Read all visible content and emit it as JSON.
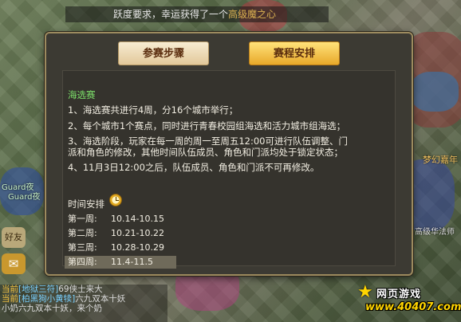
{
  "notice": {
    "prefix": "跃度要求，幸运获得了一个",
    "highlight": "高级魔之心"
  },
  "side": {
    "guard1": "Guard夜",
    "guard2": "Guard夜",
    "friend": "好友",
    "chat_icon": "chat-bubble-icon"
  },
  "right_signs": {
    "sign1": "梦幻嘉年",
    "sign2": "高级华法师"
  },
  "chat": [
    {
      "channel": "当前",
      "name": "[地狱三符]",
      "text": "69侠士来大"
    },
    {
      "channel": "当前",
      "name": "[柏黑狗小黄犊]",
      "text": "六九双本十妖"
    },
    {
      "channel": "",
      "name": "",
      "text": "小奶六九双本十妖，来个奶"
    }
  ],
  "dialog": {
    "tabs": [
      {
        "label": "参赛步骤",
        "active": false
      },
      {
        "label": "赛程安排",
        "active": true
      }
    ],
    "section_title": "海选赛",
    "rules": [
      "1、海选赛共进行4周，分16个城市举行；",
      "2、每个城市1个赛点，同时进行青春校园组海选和活力城市组海选；",
      "3、海选阶段，玩家在每一周的周一至周五12:00可进行队伍调整、门派和角色的修改，其他时间队伍成员、角色和门派均处于锁定状态；",
      "4、11月3日12:00之后，队伍成员、角色和门派不可再修改。"
    ],
    "schedule_title": "时间安排",
    "schedule": [
      {
        "week": "第一周:",
        "range": "10.14-10.15"
      },
      {
        "week": "第二周:",
        "range": "10.21-10.22"
      },
      {
        "week": "第三周:",
        "range": "10.28-10.29"
      },
      {
        "week": "第四周:",
        "range": "11.4-11.5"
      }
    ]
  },
  "watermark": {
    "top": "网页游戏",
    "url": "www.40407.com"
  },
  "colors": {
    "section_green": "#7de06a",
    "tab_active": "#e8a92a",
    "dialog_bg": "#3c3a33"
  }
}
